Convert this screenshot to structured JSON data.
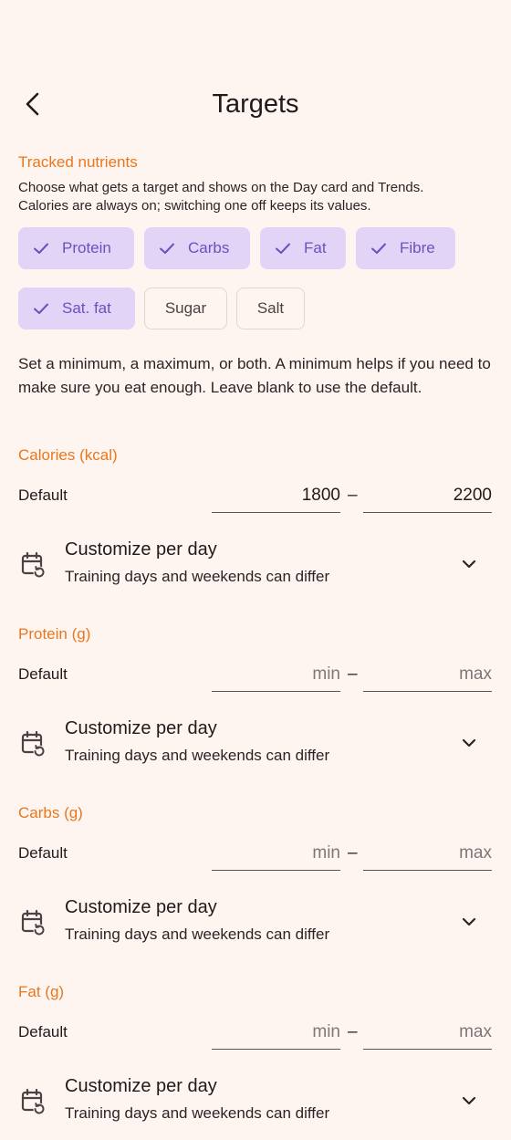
{
  "header": {
    "title": "Targets",
    "back_icon": "chevron-left-icon"
  },
  "tracked": {
    "label": "Tracked nutrients",
    "description_line1": "Choose what gets a target and shows on the Day card and Trends.",
    "description_line2": "Calories are always on; switching one off keeps its values.",
    "chips": [
      {
        "label": "Protein",
        "selected": true
      },
      {
        "label": "Carbs",
        "selected": true
      },
      {
        "label": "Fat",
        "selected": true
      },
      {
        "label": "Fibre",
        "selected": true
      },
      {
        "label": "Sat. fat",
        "selected": true
      },
      {
        "label": "Sugar",
        "selected": false
      },
      {
        "label": "Salt",
        "selected": false
      }
    ]
  },
  "intro": "Set a minimum, a maximum, or both. A minimum helps if you need to make sure you eat enough. Leave blank to use the default.",
  "sections": [
    {
      "label": "Calories (kcal)",
      "row_label": "Default",
      "min_value": "1800",
      "max_value": "2200",
      "min_placeholder": "min",
      "max_placeholder": "max",
      "dash": "–",
      "customize_title": "Customize per day",
      "customize_sub": "Training days and weekends can differ"
    },
    {
      "label": "Protein (g)",
      "row_label": "Default",
      "min_value": "",
      "max_value": "",
      "min_placeholder": "min",
      "max_placeholder": "max",
      "dash": "–",
      "customize_title": "Customize per day",
      "customize_sub": "Training days and weekends can differ"
    },
    {
      "label": "Carbs (g)",
      "row_label": "Default",
      "min_value": "",
      "max_value": "",
      "min_placeholder": "min",
      "max_placeholder": "max",
      "dash": "–",
      "customize_title": "Customize per day",
      "customize_sub": "Training days and weekends can differ"
    },
    {
      "label": "Fat (g)",
      "row_label": "Default",
      "min_value": "",
      "max_value": "",
      "min_placeholder": "min",
      "max_placeholder": "max",
      "dash": "–",
      "customize_title": "Customize per day",
      "customize_sub": "Training days and weekends can differ"
    }
  ],
  "colors": {
    "accent": "#E8771E",
    "chip_selected_bg": "#E2D4F7",
    "chip_selected_fg": "#6E4FBF",
    "background": "#FFF5F0"
  }
}
